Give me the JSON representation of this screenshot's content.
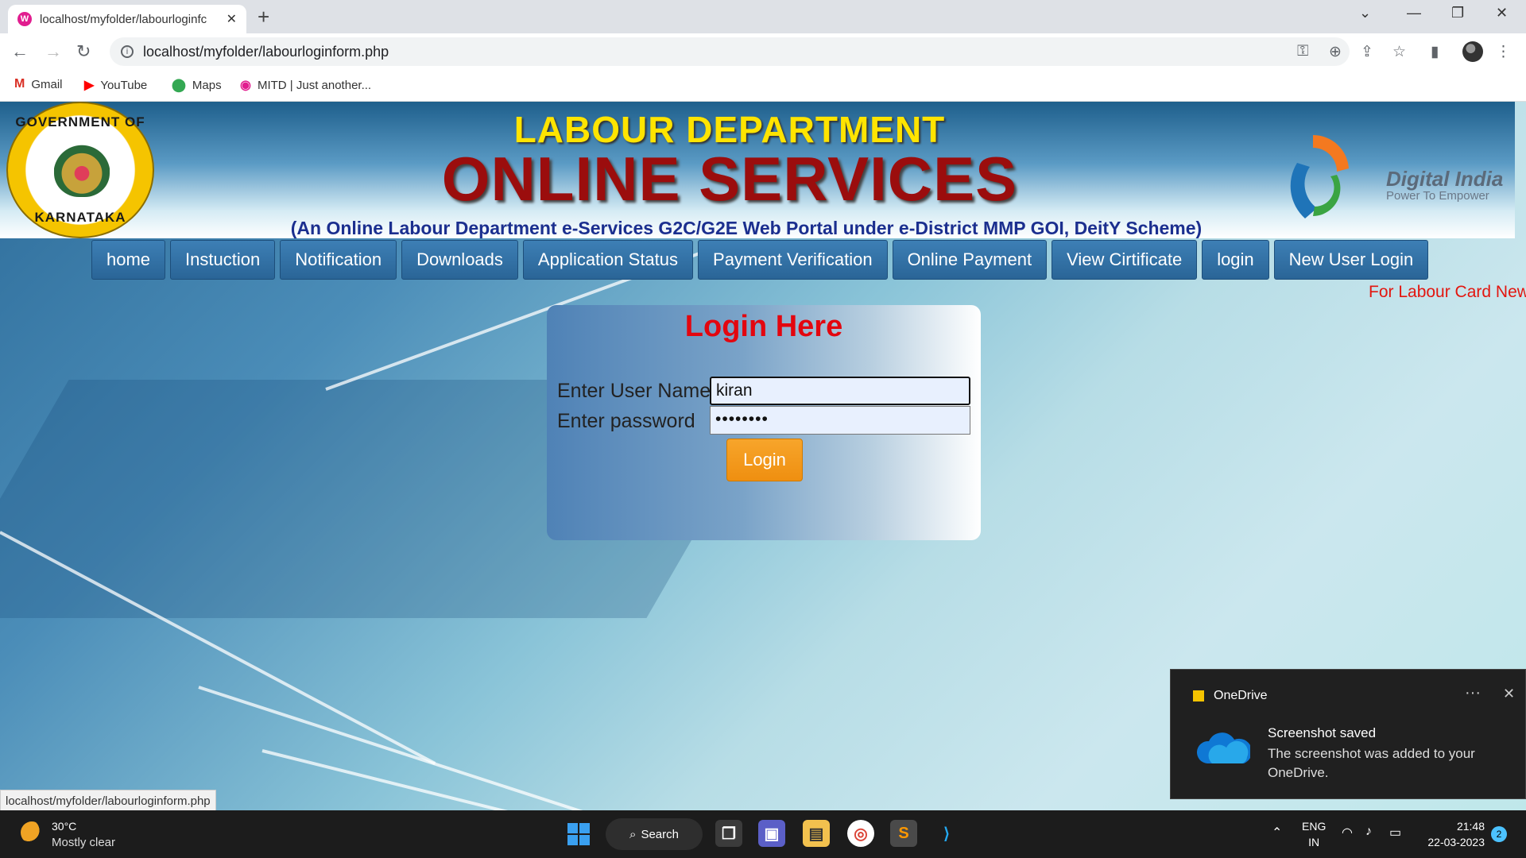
{
  "browser": {
    "tab_title": "localhost/myfolder/labourloginfc",
    "url": "localhost/myfolder/labourloginform.php",
    "bookmarks": [
      "Gmail",
      "YouTube",
      "Maps",
      "MITD | Just another..."
    ]
  },
  "banner": {
    "title": "LABOUR DEPARTMENT",
    "subtitle": "ONLINE SERVICES",
    "tagline": "(An Online Labour Department e-Services G2C/G2E Web Portal under e-District MMP GOI, DeitY Scheme)",
    "emblem_top": "GOVERNMENT OF",
    "emblem_bottom": "KARNATAKA",
    "digital_india": "Digital India",
    "digital_india_tag": "Power To Empower"
  },
  "menu": [
    "home",
    "Instuction",
    "Notification",
    "Downloads",
    "Application Status",
    "Payment Verification",
    "Online Payment",
    "View Cirtificate",
    "login",
    "New User Login"
  ],
  "marquee": "For Labour Card New",
  "login": {
    "heading": "Login Here",
    "username_label": "Enter User Name",
    "username_value": "kiran",
    "password_label": "Enter password",
    "password_value": "••••••••",
    "button": "Login"
  },
  "statusbar": "localhost/myfolder/labourloginform.php",
  "toast": {
    "app": "OneDrive",
    "title": "Screenshot saved",
    "body": "The screenshot was added to your OneDrive."
  },
  "taskbar": {
    "temp": "30°C",
    "weather": "Mostly clear",
    "search": "Search",
    "lang1": "ENG",
    "lang2": "IN",
    "time": "21:48",
    "date": "22-03-2023",
    "notifications": "2"
  },
  "colors": {
    "menu_bg": "#2a6597",
    "heading_red": "#e3060f",
    "title_yellow": "#ffe400",
    "subtitle_red": "#9b0d0d",
    "tagline_blue": "#1b2f8f",
    "login_button": "#ef8f10"
  }
}
